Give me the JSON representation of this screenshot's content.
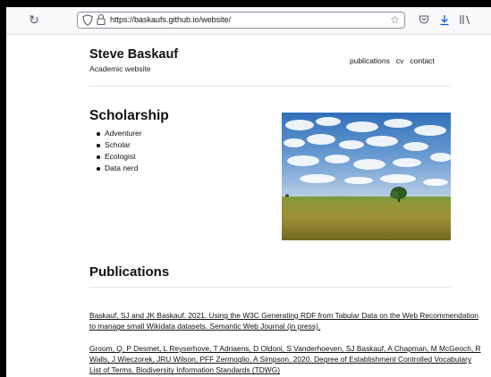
{
  "browser": {
    "url": "https://baskaufs.github.io/website/",
    "icons": {
      "reload": "reload-icon",
      "tracking": "shield-icon",
      "lock": "lock-icon",
      "bookmark": "star-icon",
      "pocket": "pocket-icon",
      "download": "download-icon",
      "library": "library-icon"
    }
  },
  "header": {
    "title": "Steve Baskauf",
    "subtitle": "Academic website",
    "nav": [
      "publications",
      "cv",
      "contact"
    ]
  },
  "scholarship": {
    "heading": "Scholarship",
    "items": [
      "Adventurer",
      "Scholar",
      "Ecologist",
      "Data nerd"
    ]
  },
  "publications": {
    "heading": "Publications",
    "entries": [
      "Baskauf, SJ and JK Baskauf. 2021. Using the W3C Generating RDF from Tabular Data on the Web Recommendation to manage small Wikidata datasets. Semantic Web Journal (in press).",
      "Groom, Q, P Desmet, L Reyserhove, T Adriaens, D Oldoni, S Vanderhoeven, SJ Baskauf, A Chapman, M McGeoch, R Walls, J Wieczorek, JRU Wilson, PFF Zermoglio, A Simpson. 2020. Degree of Establishment Controlled Vocabulary List of Terms. Biodiversity Information Standards (TDWG)"
    ]
  }
}
